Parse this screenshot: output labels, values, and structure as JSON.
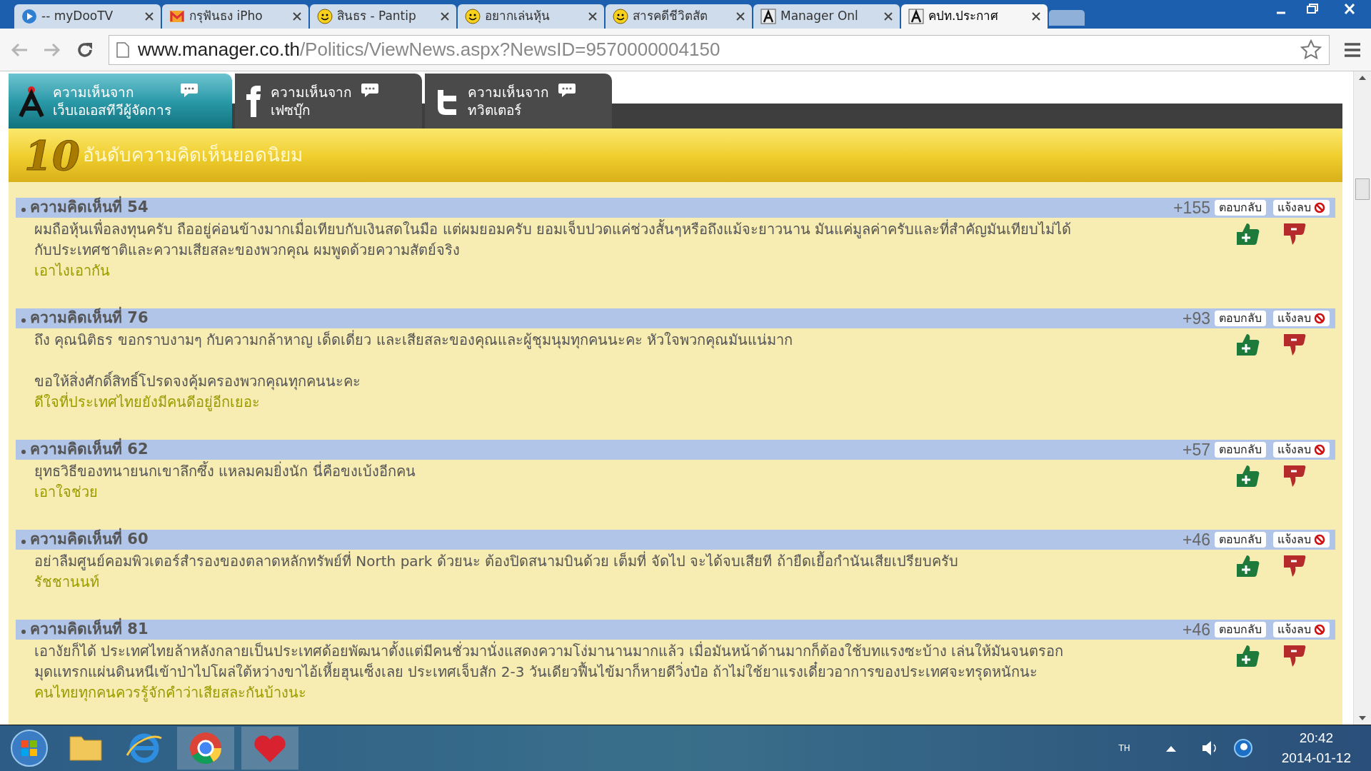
{
  "browser": {
    "tabs": [
      {
        "kind": "mydoo",
        "title": "-- myDooTV",
        "selected": false
      },
      {
        "kind": "mail",
        "title": "กรุฟันธง iPho",
        "selected": false
      },
      {
        "kind": "smiley",
        "title": "สินธร - Pantip",
        "selected": false
      },
      {
        "kind": "smiley",
        "title": "อยากเล่นหุ้น",
        "selected": false
      },
      {
        "kind": "smiley",
        "title": "สารคดีชีวิตสัต",
        "selected": false
      },
      {
        "kind": "manager",
        "title": "Manager Onl",
        "selected": false
      },
      {
        "kind": "manager",
        "title": "คปท.ประกาศ",
        "selected": true
      }
    ],
    "url_host": "www.manager.co.th",
    "url_path": "/Politics/ViewNews.aspx?NewsID=9570000004150"
  },
  "comment_sources": [
    {
      "kind": "manager",
      "line1": "ความเห็นจาก",
      "line2": "เว็บเอเอสทีวีผู้จัดการ",
      "selected": true
    },
    {
      "kind": "facebook",
      "line1": "ความเห็นจาก",
      "line2": "เฟซบุ๊ก",
      "selected": false
    },
    {
      "kind": "twitter",
      "line1": "ความเห็นจาก",
      "line2": "ทวิตเตอร์",
      "selected": false
    }
  ],
  "banner": {
    "number": "10",
    "title": "อันดับความคิดเห็นยอดนิยม"
  },
  "comments": [
    {
      "heading": "ความคิดเห็นที่ 54",
      "score": "+155",
      "reply": "ตอบกลับ",
      "report": "แจ้งลบ",
      "body": [
        "ผมถือหุ้นเพื่อลงทุนครับ ถืออยู่ค่อนข้างมากเมื่อเทียบกับเงินสดในมือ แต่ผมยอมครับ ยอมเจ็บปวดแค่ช่วงสั้นๆหรือถึงแม้จะยาวนาน มันแค่มูลค่าครับและที่สำคัญมันเทียบไม่ได้ กับประเทศชาติและความเสียสละของพวกคุณ ผมพูดด้วยความสัตย์จริง"
      ],
      "signature": "เอาไงเอากัน"
    },
    {
      "heading": "ความคิดเห็นที่ 76",
      "score": "+93",
      "reply": "ตอบกลับ",
      "report": "แจ้งลบ",
      "body": [
        "ถึง คุณนิติธร ขอกราบงามๆ กับความกล้าหาญ เด็ดเดี่ยว และเสียสละของคุณและผู้ชุมนุมทุกคนนะคะ หัวใจพวกคุณมันแน่มาก",
        "ขอให้สิ่งศักดิ์สิทธิ์โปรดจงคุ้มครองพวกคุณทุกคนนะคะ"
      ],
      "signature": "ดีใจที่ประเทศไทยยังมีคนดีอยู่อีกเยอะ"
    },
    {
      "heading": "ความคิดเห็นที่ 62",
      "score": "+57",
      "reply": "ตอบกลับ",
      "report": "แจ้งลบ",
      "body": [
        "ยุทธวิธีของทนายนกเขาลึกซึ้ง แหลมคมยิ่งนัก นี่คือขงเบ้งอีกคน"
      ],
      "signature": "เอาใจช่วย"
    },
    {
      "heading": "ความคิดเห็นที่ 60",
      "score": "+46",
      "reply": "ตอบกลับ",
      "report": "แจ้งลบ",
      "body": [
        "อย่าลืมศูนย์คอมพิวเตอร์สำรองของตลาดหลักทรัพย์ที่ North park ด้วยนะ ต้องปิดสนามบินด้วย เต็มที่ จัดไป จะได้จบเสียที ถ้ายืดเยื้อกำนันเสียเปรียบครับ"
      ],
      "signature": "รัชชานนท์"
    },
    {
      "heading": "ความคิดเห็นที่ 81",
      "score": "+46",
      "reply": "ตอบกลับ",
      "report": "แจ้งลบ",
      "body": [
        "เอางัยก็ได้ ประเทศไทยล้าหลังกลายเป็นประเทศด้อยพัฒนาตั้งแต่มีคนชั่วมานั่งแสดงความโง่มานานมากแล้ว เมื่อมันหน้าด้านมากก็ต้องใช้บทแรงซะบ้าง เล่นให้มันจนตรอก มุดแทรกแผ่นดินหนีเข้าป่าไปโผล่ใต้หว่างขาไอ้เหี้ยฮุนเซ็งเลย ประเทศเจ็บสัก 2-3 วันเดียวฟื้นไข้มาก็หายดีวิ่งป๋อ ถ้าไม่ใช้ยาแรงเดี๋ยวอาการของประเทศจะทรุดหนักนะ"
      ],
      "signature": "คนไทยทุกคนควรรู้จักคำว่าเสียสละกันบ้างนะ"
    }
  ],
  "taskbar": {
    "language": "TH",
    "time": "20:42",
    "date": "2014-01-12"
  }
}
